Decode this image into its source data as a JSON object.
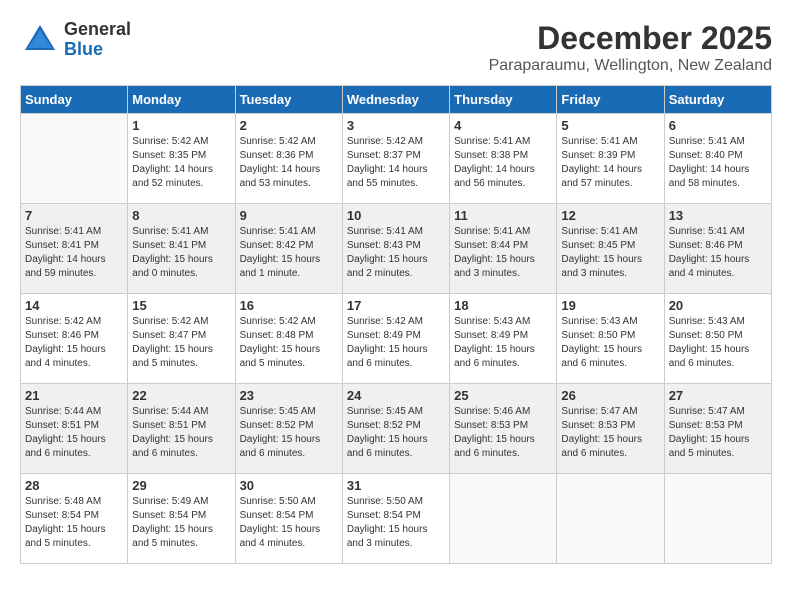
{
  "logo": {
    "general": "General",
    "blue": "Blue"
  },
  "title": "December 2025",
  "location": "Paraparaumu, Wellington, New Zealand",
  "days_of_week": [
    "Sunday",
    "Monday",
    "Tuesday",
    "Wednesday",
    "Thursday",
    "Friday",
    "Saturday"
  ],
  "weeks": [
    [
      {
        "day": "",
        "info": ""
      },
      {
        "day": "1",
        "info": "Sunrise: 5:42 AM\nSunset: 8:35 PM\nDaylight: 14 hours\nand 52 minutes."
      },
      {
        "day": "2",
        "info": "Sunrise: 5:42 AM\nSunset: 8:36 PM\nDaylight: 14 hours\nand 53 minutes."
      },
      {
        "day": "3",
        "info": "Sunrise: 5:42 AM\nSunset: 8:37 PM\nDaylight: 14 hours\nand 55 minutes."
      },
      {
        "day": "4",
        "info": "Sunrise: 5:41 AM\nSunset: 8:38 PM\nDaylight: 14 hours\nand 56 minutes."
      },
      {
        "day": "5",
        "info": "Sunrise: 5:41 AM\nSunset: 8:39 PM\nDaylight: 14 hours\nand 57 minutes."
      },
      {
        "day": "6",
        "info": "Sunrise: 5:41 AM\nSunset: 8:40 PM\nDaylight: 14 hours\nand 58 minutes."
      }
    ],
    [
      {
        "day": "7",
        "info": "Sunrise: 5:41 AM\nSunset: 8:41 PM\nDaylight: 14 hours\nand 59 minutes."
      },
      {
        "day": "8",
        "info": "Sunrise: 5:41 AM\nSunset: 8:41 PM\nDaylight: 15 hours\nand 0 minutes."
      },
      {
        "day": "9",
        "info": "Sunrise: 5:41 AM\nSunset: 8:42 PM\nDaylight: 15 hours\nand 1 minute."
      },
      {
        "day": "10",
        "info": "Sunrise: 5:41 AM\nSunset: 8:43 PM\nDaylight: 15 hours\nand 2 minutes."
      },
      {
        "day": "11",
        "info": "Sunrise: 5:41 AM\nSunset: 8:44 PM\nDaylight: 15 hours\nand 3 minutes."
      },
      {
        "day": "12",
        "info": "Sunrise: 5:41 AM\nSunset: 8:45 PM\nDaylight: 15 hours\nand 3 minutes."
      },
      {
        "day": "13",
        "info": "Sunrise: 5:41 AM\nSunset: 8:46 PM\nDaylight: 15 hours\nand 4 minutes."
      }
    ],
    [
      {
        "day": "14",
        "info": "Sunrise: 5:42 AM\nSunset: 8:46 PM\nDaylight: 15 hours\nand 4 minutes."
      },
      {
        "day": "15",
        "info": "Sunrise: 5:42 AM\nSunset: 8:47 PM\nDaylight: 15 hours\nand 5 minutes."
      },
      {
        "day": "16",
        "info": "Sunrise: 5:42 AM\nSunset: 8:48 PM\nDaylight: 15 hours\nand 5 minutes."
      },
      {
        "day": "17",
        "info": "Sunrise: 5:42 AM\nSunset: 8:49 PM\nDaylight: 15 hours\nand 6 minutes."
      },
      {
        "day": "18",
        "info": "Sunrise: 5:43 AM\nSunset: 8:49 PM\nDaylight: 15 hours\nand 6 minutes."
      },
      {
        "day": "19",
        "info": "Sunrise: 5:43 AM\nSunset: 8:50 PM\nDaylight: 15 hours\nand 6 minutes."
      },
      {
        "day": "20",
        "info": "Sunrise: 5:43 AM\nSunset: 8:50 PM\nDaylight: 15 hours\nand 6 minutes."
      }
    ],
    [
      {
        "day": "21",
        "info": "Sunrise: 5:44 AM\nSunset: 8:51 PM\nDaylight: 15 hours\nand 6 minutes."
      },
      {
        "day": "22",
        "info": "Sunrise: 5:44 AM\nSunset: 8:51 PM\nDaylight: 15 hours\nand 6 minutes."
      },
      {
        "day": "23",
        "info": "Sunrise: 5:45 AM\nSunset: 8:52 PM\nDaylight: 15 hours\nand 6 minutes."
      },
      {
        "day": "24",
        "info": "Sunrise: 5:45 AM\nSunset: 8:52 PM\nDaylight: 15 hours\nand 6 minutes."
      },
      {
        "day": "25",
        "info": "Sunrise: 5:46 AM\nSunset: 8:53 PM\nDaylight: 15 hours\nand 6 minutes."
      },
      {
        "day": "26",
        "info": "Sunrise: 5:47 AM\nSunset: 8:53 PM\nDaylight: 15 hours\nand 6 minutes."
      },
      {
        "day": "27",
        "info": "Sunrise: 5:47 AM\nSunset: 8:53 PM\nDaylight: 15 hours\nand 5 minutes."
      }
    ],
    [
      {
        "day": "28",
        "info": "Sunrise: 5:48 AM\nSunset: 8:54 PM\nDaylight: 15 hours\nand 5 minutes."
      },
      {
        "day": "29",
        "info": "Sunrise: 5:49 AM\nSunset: 8:54 PM\nDaylight: 15 hours\nand 5 minutes."
      },
      {
        "day": "30",
        "info": "Sunrise: 5:50 AM\nSunset: 8:54 PM\nDaylight: 15 hours\nand 4 minutes."
      },
      {
        "day": "31",
        "info": "Sunrise: 5:50 AM\nSunset: 8:54 PM\nDaylight: 15 hours\nand 3 minutes."
      },
      {
        "day": "",
        "info": ""
      },
      {
        "day": "",
        "info": ""
      },
      {
        "day": "",
        "info": ""
      }
    ]
  ]
}
